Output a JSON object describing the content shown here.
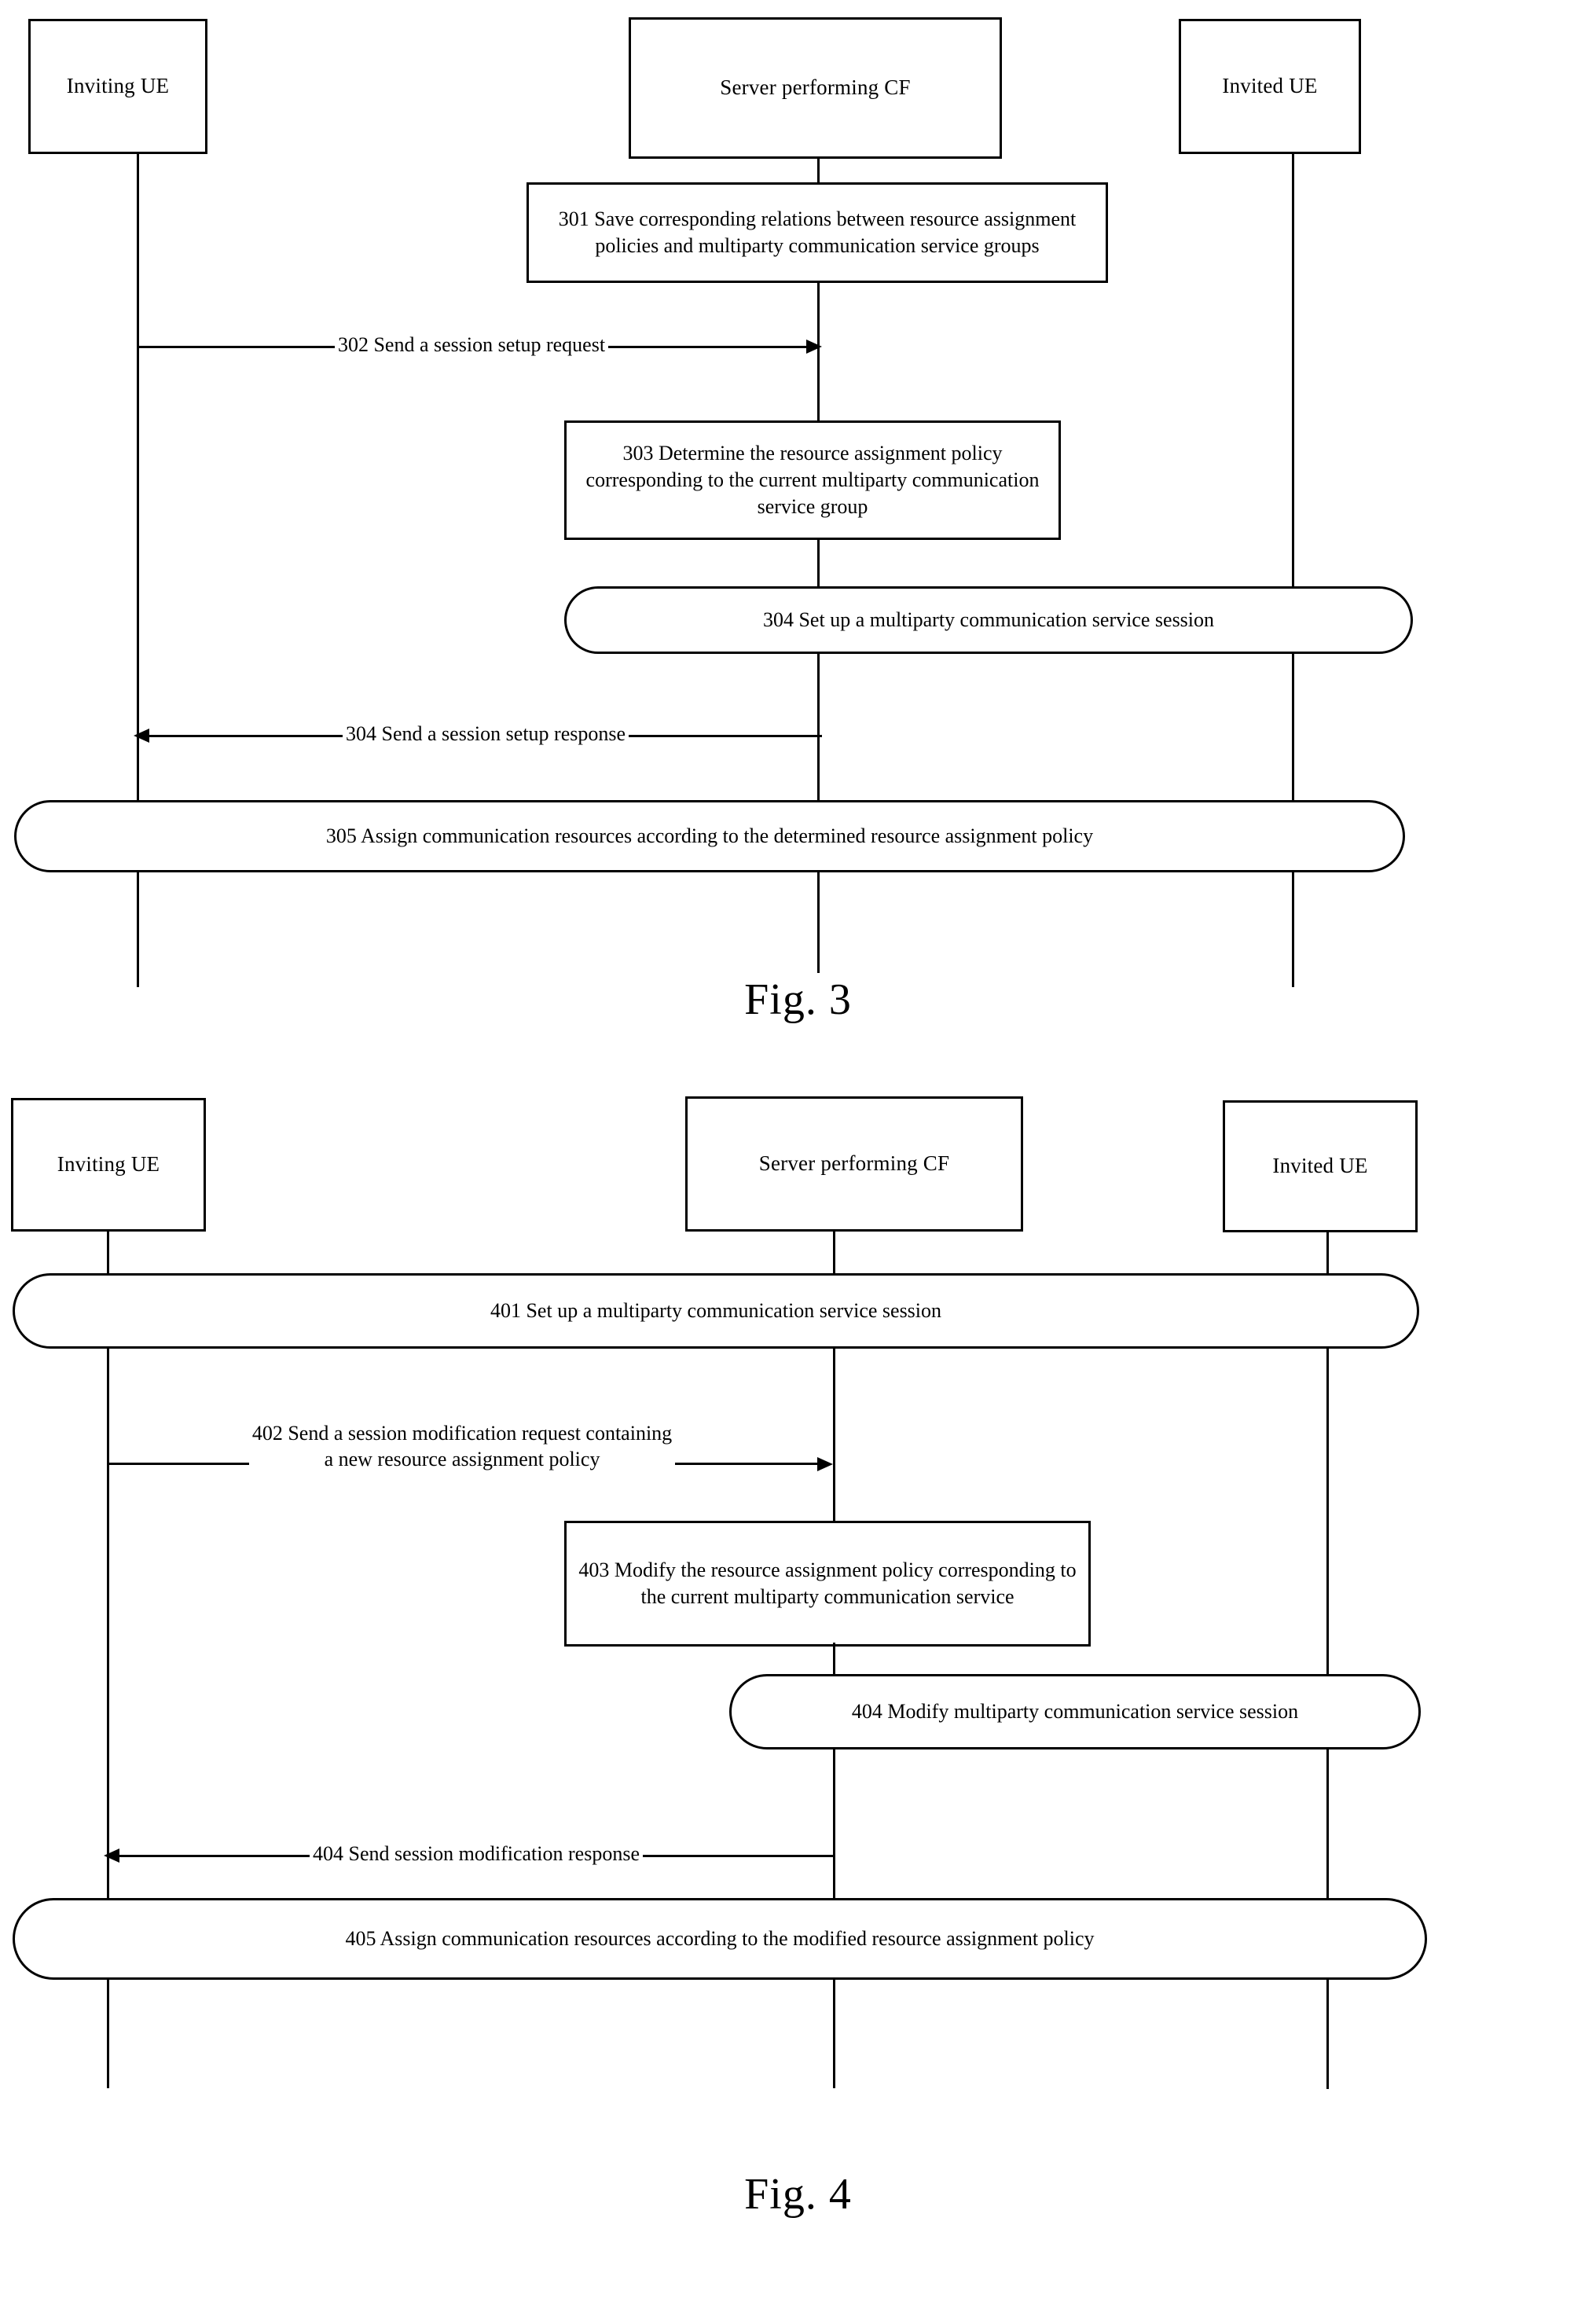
{
  "figures": [
    {
      "caption": "Fig. 3",
      "actors": [
        {
          "label": "Inviting UE"
        },
        {
          "label": "Server performing CF"
        },
        {
          "label": "Invited UE"
        }
      ],
      "steps": [
        {
          "id": "301",
          "kind": "process-box",
          "text": "301 Save corresponding relations between resource assignment policies and multiparty communication service groups"
        },
        {
          "id": "302",
          "kind": "message",
          "direction": "right",
          "from": "Inviting UE",
          "to": "Server performing CF",
          "text": "302 Send a session setup request"
        },
        {
          "id": "303",
          "kind": "process-box",
          "text": "303 Determine the resource assignment policy corresponding to the current multiparty communication service group"
        },
        {
          "id": "304a",
          "kind": "rounded-box",
          "text": "304 Set up a multiparty communication service session"
        },
        {
          "id": "304b",
          "kind": "message",
          "direction": "left",
          "from": "Server performing CF",
          "to": "Inviting UE",
          "text": "304 Send a session setup response"
        },
        {
          "id": "305",
          "kind": "rounded-box",
          "text": "305 Assign communication resources according to the determined resource assignment policy"
        }
      ]
    },
    {
      "caption": "Fig. 4",
      "actors": [
        {
          "label": "Inviting UE"
        },
        {
          "label": "Server performing CF"
        },
        {
          "label": "Invited UE"
        }
      ],
      "steps": [
        {
          "id": "401",
          "kind": "rounded-box",
          "text": "401 Set up a multiparty communication service session"
        },
        {
          "id": "402",
          "kind": "message",
          "direction": "right",
          "from": "Inviting UE",
          "to": "Server performing CF",
          "text": "402 Send a session modification request containing\na new resource assignment policy"
        },
        {
          "id": "403",
          "kind": "process-box",
          "text": "403 Modify the resource assignment policy corresponding to the current multiparty communication service"
        },
        {
          "id": "404a",
          "kind": "rounded-box",
          "text": "404 Modify multiparty communication service session"
        },
        {
          "id": "404b",
          "kind": "message",
          "direction": "left",
          "from": "Server performing CF",
          "to": "Inviting UE",
          "text": "404 Send session modification response"
        },
        {
          "id": "405",
          "kind": "rounded-box",
          "text": "405 Assign communication resources according to the modified resource assignment policy"
        }
      ]
    }
  ],
  "colors": {
    "ink": "#000000",
    "paper": "#ffffff"
  }
}
